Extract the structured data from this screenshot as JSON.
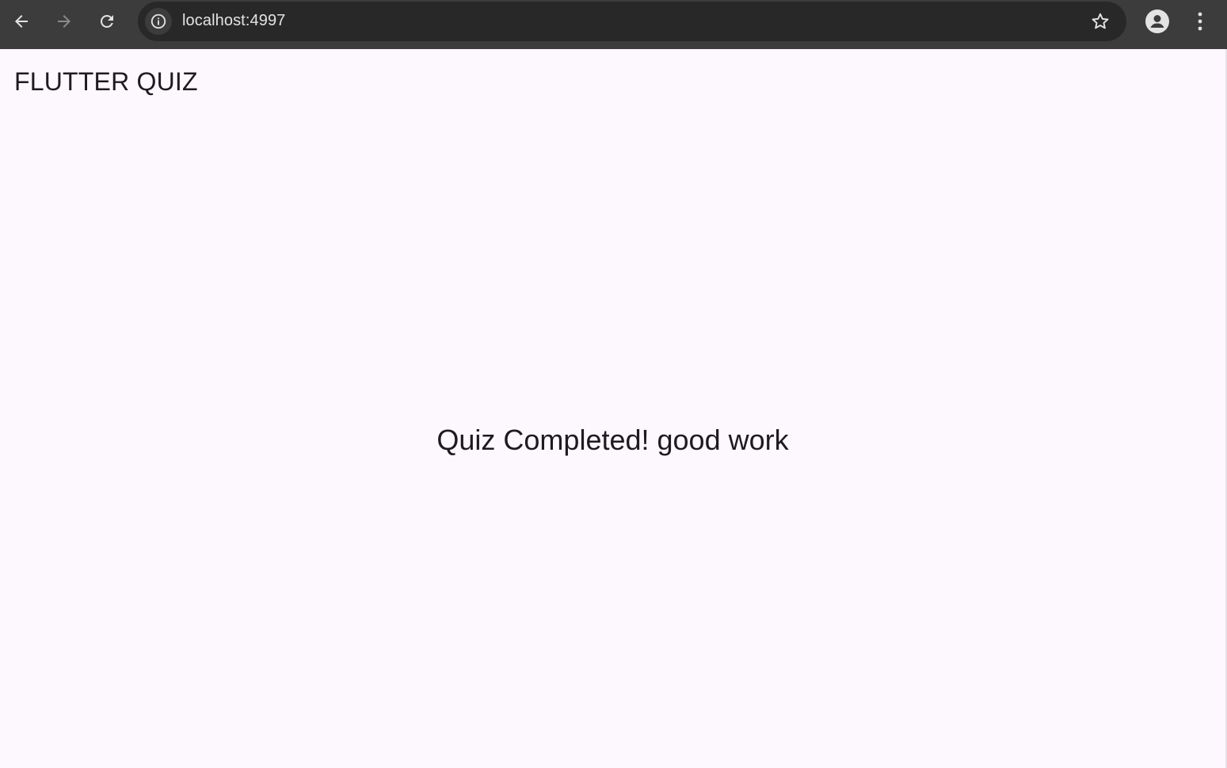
{
  "browser": {
    "url": "localhost:4997",
    "icons": [
      "back-arrow-icon",
      "forward-arrow-icon",
      "reload-icon",
      "info-icon",
      "star-icon",
      "profile-icon",
      "more-vert-icon"
    ]
  },
  "app": {
    "title": "FLUTTER QUIZ",
    "completion_message": "Quiz Completed! good work"
  },
  "colors": {
    "toolbar": "#3c3c3c",
    "omnibox": "#282828",
    "page_background": "#fdf7fe",
    "text": "#1d1b20"
  }
}
